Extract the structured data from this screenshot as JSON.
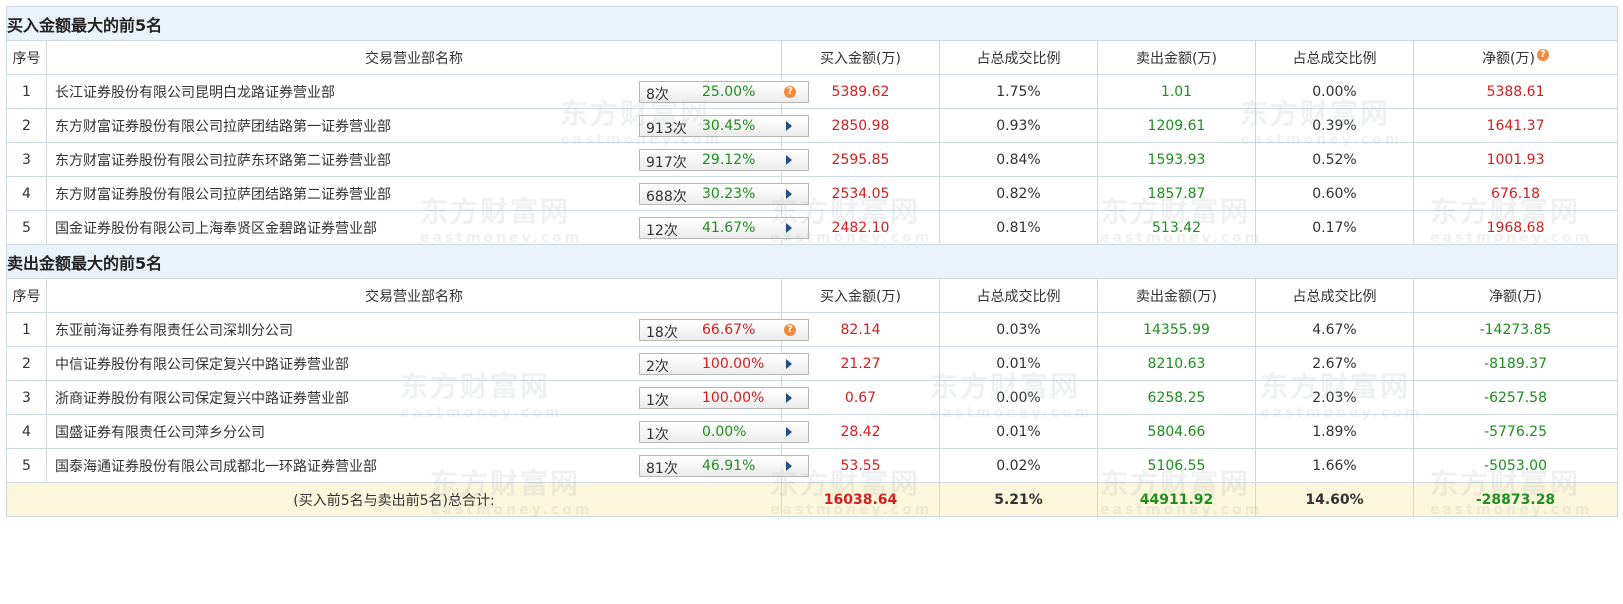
{
  "sections": {
    "buy_title": "买入金额最大的前5名",
    "sell_title": "卖出金额最大的前5名"
  },
  "headers": {
    "index": "序号",
    "branch": "交易营业部名称",
    "buy_amount": "买入金额(万)",
    "buy_ratio": "占总成交比例",
    "sell_amount": "卖出金额(万)",
    "sell_ratio": "占总成交比例",
    "net": "净额(万)"
  },
  "buy_rows": [
    {
      "idx": "1",
      "name": "长江证券股份有限公司昆明白龙路证券营业部",
      "count": "8次",
      "pct": "25.00%",
      "pct_color": "green",
      "icon": "question-icon",
      "buy": "5389.62",
      "buy_ratio": "1.75%",
      "sell": "1.01",
      "sell_ratio": "0.00%",
      "net": "5388.61",
      "net_color": "red"
    },
    {
      "idx": "2",
      "name": "东方财富证券股份有限公司拉萨团结路第一证券营业部",
      "count": "913次",
      "pct": "30.45%",
      "pct_color": "green",
      "icon": "arrow-right-icon",
      "buy": "2850.98",
      "buy_ratio": "0.93%",
      "sell": "1209.61",
      "sell_ratio": "0.39%",
      "net": "1641.37",
      "net_color": "red"
    },
    {
      "idx": "3",
      "name": "东方财富证券股份有限公司拉萨东环路第二证券营业部",
      "count": "917次",
      "pct": "29.12%",
      "pct_color": "green",
      "icon": "arrow-right-icon",
      "buy": "2595.85",
      "buy_ratio": "0.84%",
      "sell": "1593.93",
      "sell_ratio": "0.52%",
      "net": "1001.93",
      "net_color": "red"
    },
    {
      "idx": "4",
      "name": "东方财富证券股份有限公司拉萨团结路第二证券营业部",
      "count": "688次",
      "pct": "30.23%",
      "pct_color": "green",
      "icon": "arrow-right-icon",
      "buy": "2534.05",
      "buy_ratio": "0.82%",
      "sell": "1857.87",
      "sell_ratio": "0.60%",
      "net": "676.18",
      "net_color": "red"
    },
    {
      "idx": "5",
      "name": "国金证券股份有限公司上海奉贤区金碧路证券营业部",
      "count": "12次",
      "pct": "41.67%",
      "pct_color": "green",
      "icon": "arrow-right-icon",
      "buy": "2482.10",
      "buy_ratio": "0.81%",
      "sell": "513.42",
      "sell_ratio": "0.17%",
      "net": "1968.68",
      "net_color": "red"
    }
  ],
  "sell_rows": [
    {
      "idx": "1",
      "name": "东亚前海证券有限责任公司深圳分公司",
      "count": "18次",
      "pct": "66.67%",
      "pct_color": "red",
      "icon": "question-icon",
      "buy": "82.14",
      "buy_ratio": "0.03%",
      "sell": "14355.99",
      "sell_ratio": "4.67%",
      "net": "-14273.85",
      "net_color": "green"
    },
    {
      "idx": "2",
      "name": "中信证券股份有限公司保定复兴中路证券营业部",
      "count": "2次",
      "pct": "100.00%",
      "pct_color": "red",
      "icon": "arrow-right-icon",
      "buy": "21.27",
      "buy_ratio": "0.01%",
      "sell": "8210.63",
      "sell_ratio": "2.67%",
      "net": "-8189.37",
      "net_color": "green"
    },
    {
      "idx": "3",
      "name": "浙商证券股份有限公司保定复兴中路证券营业部",
      "count": "1次",
      "pct": "100.00%",
      "pct_color": "red",
      "icon": "arrow-right-icon",
      "buy": "0.67",
      "buy_ratio": "0.00%",
      "sell": "6258.25",
      "sell_ratio": "2.03%",
      "net": "-6257.58",
      "net_color": "green"
    },
    {
      "idx": "4",
      "name": "国盛证券有限责任公司萍乡分公司",
      "count": "1次",
      "pct": "0.00%",
      "pct_color": "green",
      "icon": "arrow-right-icon",
      "buy": "28.42",
      "buy_ratio": "0.01%",
      "sell": "5804.66",
      "sell_ratio": "1.89%",
      "net": "-5776.25",
      "net_color": "green"
    },
    {
      "idx": "5",
      "name": "国泰海通证券股份有限公司成都北一环路证券营业部",
      "count": "81次",
      "pct": "46.91%",
      "pct_color": "green",
      "icon": "arrow-right-icon",
      "buy": "53.55",
      "buy_ratio": "0.02%",
      "sell": "5106.55",
      "sell_ratio": "1.66%",
      "net": "-5053.00",
      "net_color": "green"
    }
  ],
  "total": {
    "label": "(买入前5名与卖出前5名)总合计:",
    "buy": "16038.64",
    "buy_ratio": "5.21%",
    "sell": "44911.92",
    "sell_ratio": "14.60%",
    "net": "-28873.28"
  },
  "watermark": {
    "cn": "东方财富网",
    "en": "eastmoney.com"
  },
  "colors": {
    "title_bg": "#eaf3fb",
    "total_bg": "#fbf6dc",
    "red": "#d71d1d",
    "green": "#1e8f1e",
    "border": "#cfd9e5"
  }
}
